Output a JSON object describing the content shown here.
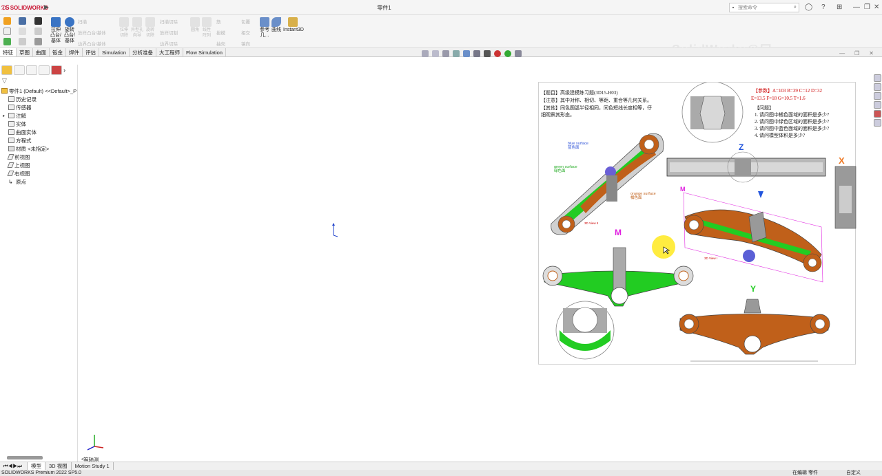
{
  "titlebar": {
    "app_logo": "SOLIDWORKS",
    "doc_title": "零件1",
    "search_placeholder": "搜索命令"
  },
  "ribbon": {
    "extrude_boss": "拉伸凸台/基体",
    "revolve_boss": "旋转凸台/基体",
    "sweep": "扫描",
    "loft": "放样凸台/基体",
    "boundary_boss": "边界凸台/基体",
    "extrude_cut": "拉伸切除",
    "hole_wizard": "异型孔向导",
    "revolve_cut": "旋转切除",
    "swept_cut": "扫描切除",
    "lofted_cut": "放样切割",
    "boundary_cut": "边界切除",
    "fillet": "圆角",
    "linear_pattern": "线性阵列",
    "rib": "筋",
    "draft": "拔模",
    "shell": "抽壳",
    "wrap": "包覆",
    "intersect": "相交",
    "mirror": "镜向",
    "reference_geometry": "参考几...",
    "curves": "曲线",
    "instant3d": "Instant3D",
    "watermark": "SolidWorks@口"
  },
  "tabs": [
    "特征",
    "草图",
    "曲面",
    "钣金",
    "焊件",
    "评估",
    "Simulation",
    "分析准备",
    "大工程师",
    "Flow Simulation"
  ],
  "feature_tree": {
    "root": "零件1 (Default) <<Default>_P",
    "items": [
      "历史记录",
      "传感器",
      "注解",
      "实体",
      "曲面实体",
      "方程式",
      "材质 <未指定>",
      "前视图",
      "上视图",
      "右视图",
      "原点"
    ]
  },
  "view_label": "*等轴测",
  "bottom_tabs": [
    "模型",
    "3D 视图",
    "Motion Study 1"
  ],
  "status": {
    "left": "SOLIDWORKS Premium 2022 SP5.0",
    "editing": "在编辑 零件",
    "custom": "自定义"
  },
  "ref_image": {
    "title_line": "【题目】高级建模练习题(3D15-H03)",
    "note_line": "【注意】其中对称、相切、等距、重合等几何关系。",
    "other_line1": "【其他】同色圆弧半径相同，同色短线长度相等，仔",
    "other_line2": "细观察其形态。",
    "params_line1": "【参数】A=103  B=39  C=12  D=32",
    "params_line2": "E=13.5  F=18  G=10.5  T=1.6",
    "question_header": "【问题】",
    "questions": [
      "1. 请问图中橘色面域的面积是多少?",
      "2. 请问图中绿色区域的面积是多少?",
      "3. 请问图中蓝色面域的面积是多少?",
      "4. 请问模型体积是多少?"
    ],
    "label_blue": "blue surface",
    "label_blue_cn": "蓝色面",
    "label_green": "green surface",
    "label_green_cn": "绿色面",
    "label_orange": "orange surface",
    "label_orange_cn": "橘色面",
    "view_z": "Z",
    "view_x": "X",
    "view_m": "M",
    "view_y": "Y",
    "view_3d2": "3D View II",
    "view_3d1": "3D View I"
  },
  "colors": {
    "orange": "#c0601a",
    "green": "#22cc22",
    "blue": "#2a4fd6",
    "magenta": "#e020e0",
    "red_text": "#cc0000",
    "accent_z": "#2255dd"
  }
}
